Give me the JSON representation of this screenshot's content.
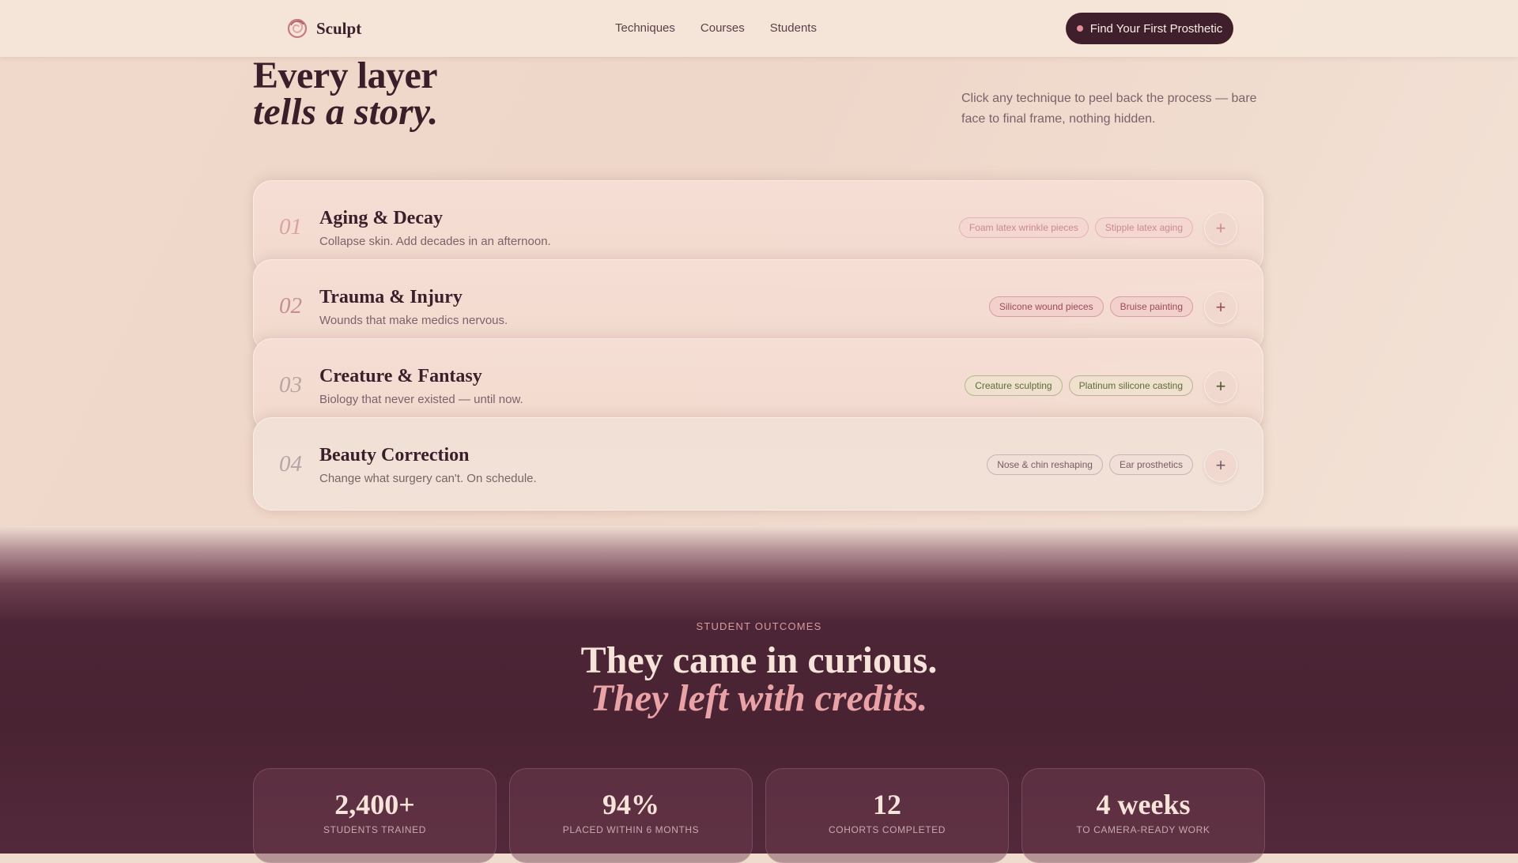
{
  "nav": {
    "brand": "Sculpt",
    "links": [
      "Techniques",
      "Courses",
      "Students"
    ],
    "cta_label": "Find Your First Prosthetic"
  },
  "hero": {
    "title_line1": "Every layer",
    "title_line2": "tells a story.",
    "intro": "Click any technique to peel back the process — bare face to final frame, nothing hidden."
  },
  "techniques": [
    {
      "number": "01",
      "title": "Aging & Decay",
      "subtitle": "Collapse skin. Add decades in an afternoon.",
      "tags": [
        "Foam latex wrinkle pieces",
        "Stipple latex aging"
      ],
      "expand_icon": "plus-icon",
      "accent": "#c98a8e"
    },
    {
      "number": "02",
      "title": "Trauma & Injury",
      "subtitle": "Wounds that make medics nervous.",
      "tags": [
        "Silicone wound pieces",
        "Bruise painting"
      ],
      "expand_icon": "plus-icon",
      "accent": "#9c4a5a"
    },
    {
      "number": "03",
      "title": "Creature & Fantasy",
      "subtitle": "Biology that never existed — until now.",
      "tags": [
        "Creature sculpting",
        "Platinum silicone casting"
      ],
      "expand_icon": "plus-icon",
      "accent": "#5e6a3a"
    },
    {
      "number": "04",
      "title": "Beauty Correction",
      "subtitle": "Change what surgery can't. On schedule.",
      "tags": [
        "Nose & chin reshaping",
        "Ear prosthetics"
      ],
      "expand_icon": "plus-icon",
      "accent": "#7a5a66"
    }
  ],
  "outcomes": {
    "eyebrow": "STUDENT OUTCOMES",
    "title_line1": "They came in curious.",
    "title_line2": "They left with credits.",
    "stats": [
      {
        "value": "2,400+",
        "label": "STUDENTS TRAINED"
      },
      {
        "value": "94%",
        "label": "PLACED WITHIN 6 MONTHS"
      },
      {
        "value": "12",
        "label": "COHORTS COMPLETED"
      },
      {
        "value": "4 weeks",
        "label": "TO CAMERA-READY WORK"
      }
    ]
  },
  "colors": {
    "ink": "#3a1f2b",
    "cta_bg": "#3f1f2c",
    "dark_section": "#4a2333",
    "rose_accent": "#e9a3a7"
  }
}
